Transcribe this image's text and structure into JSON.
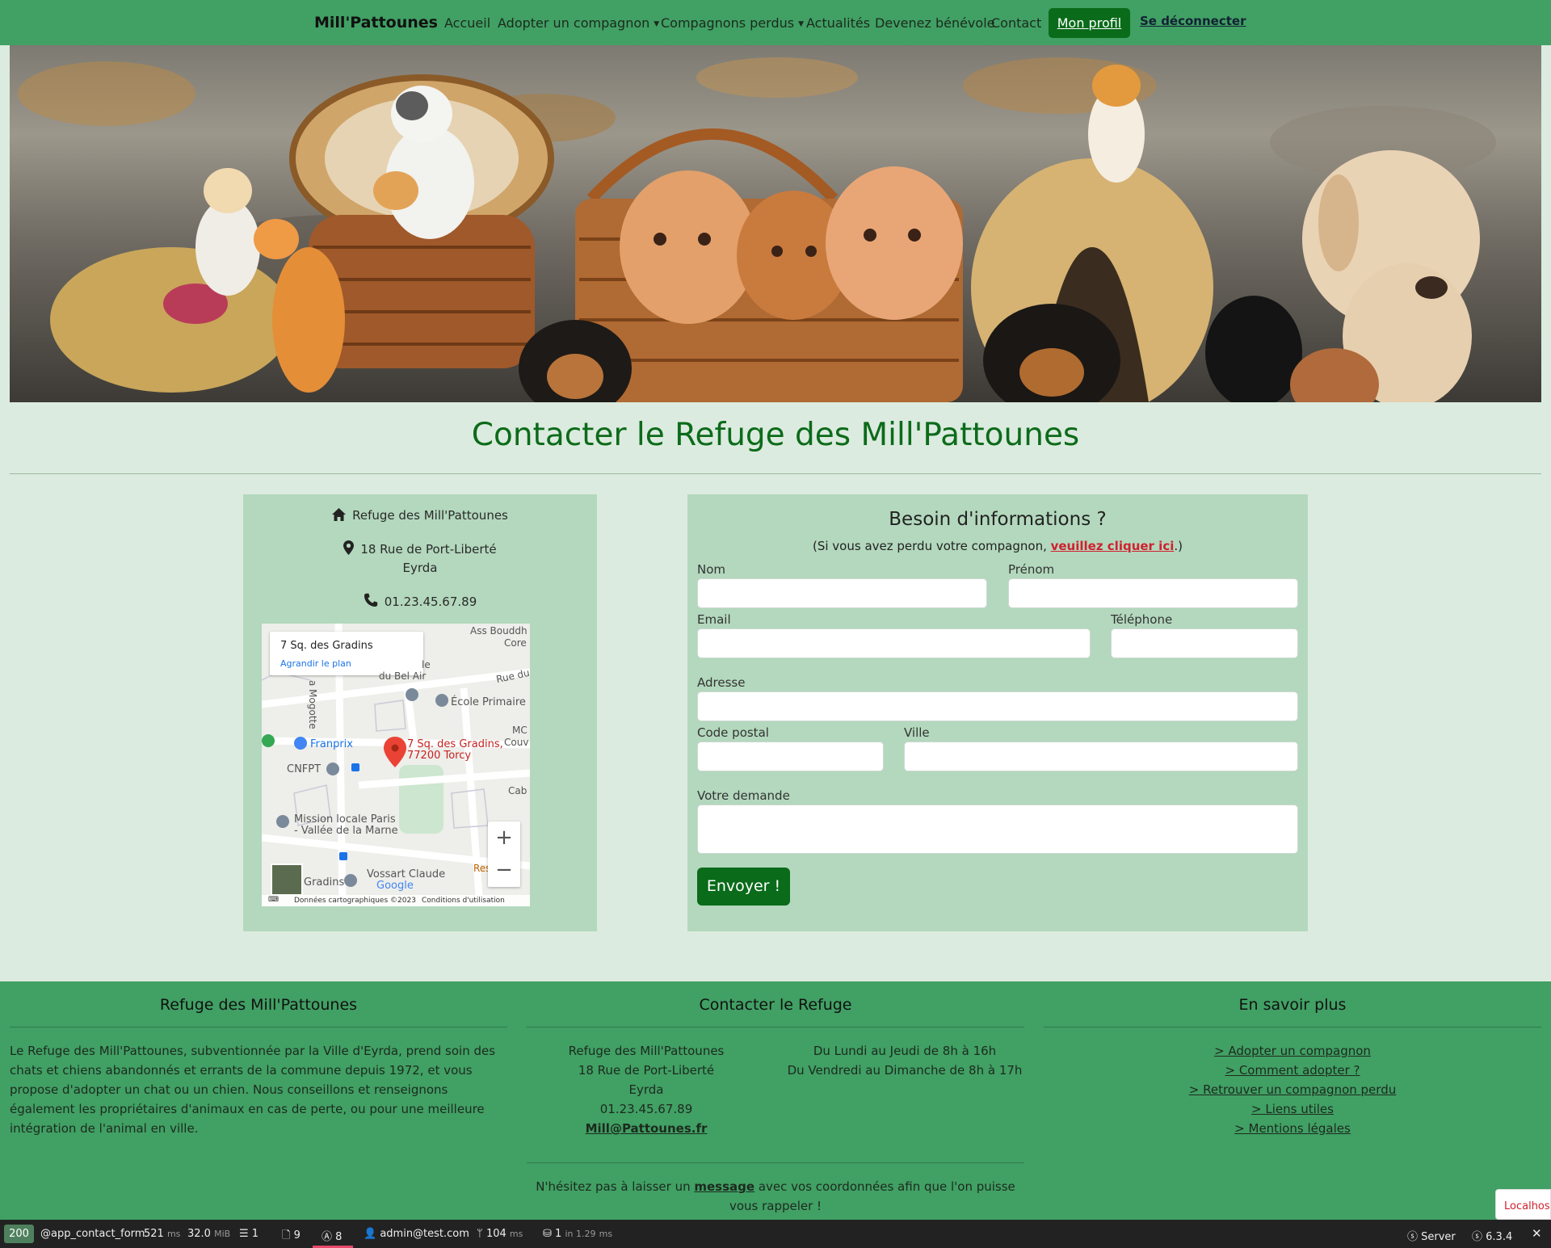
{
  "nav": {
    "brand": "Mill'Pattounes",
    "items": [
      "Accueil",
      "Adopter un compagnon",
      "Compagnons perdus",
      "Actualités",
      "Devenez bénévole",
      "Contact"
    ],
    "profile": "Mon profil",
    "logout": "Se déconnecter"
  },
  "page": {
    "title": "Contacter le Refuge des Mill'Pattounes"
  },
  "info": {
    "name": "Refuge des Mill'Pattounes",
    "street": "18 Rue de Port-Liberté",
    "city": "Eyrda",
    "phone": "01.23.45.67.89"
  },
  "map": {
    "place": "7 Sq. des Gradins",
    "enlarge": "Agrandir le plan",
    "marker_line1": "7 Sq. des Gradins,",
    "marker_line2": "77200 Torcy",
    "labels": {
      "franprix": "Franprix",
      "cnfpt": "CNFPT",
      "ecole": "École Primaire",
      "mission1": "Mission locale Paris",
      "mission2": "- Vallée de la Marne",
      "vossart": "Vossart Claude",
      "gradins": "Gradins",
      "ass": "Ass Bouddh",
      "core": "Core",
      "ruedu": "Rue du",
      "belair": "du Bel Air",
      "le": "le",
      "mc": "MC",
      "couv": "Couv",
      "cab": "Cab",
      "res": "Res",
      "mogotte": "a Mogotte",
      "google": "Google"
    },
    "footer_data": "Données cartographiques ©2023",
    "footer_terms": "Conditions d'utilisation"
  },
  "form": {
    "title": "Besoin d'informations ?",
    "sub_before": "(Si vous avez perdu votre compagnon, ",
    "sub_link": "veuillez cliquer ici",
    "sub_after": ".)",
    "labels": {
      "nom": "Nom",
      "prenom": "Prénom",
      "email": "Email",
      "telephone": "Téléphone",
      "adresse": "Adresse",
      "code_postal": "Code postal",
      "ville": "Ville",
      "demande": "Votre demande"
    },
    "submit": "Envoyer !"
  },
  "footer": {
    "col1_title": "Refuge des Mill'Pattounes",
    "col1_text": "Le Refuge des Mill'Pattounes, subventionnée par la Ville d'Eyrda, prend soin des chats et chiens abandonnés et errants de la commune depuis 1972, et vous propose d'adopter un chat ou un chien. Nous conseillons et renseignons également les propriétaires d'animaux en cas de perte, ou pour une meilleure intégration de l'animal en ville.",
    "col2_title": "Contacter le Refuge",
    "col2_name": "Refuge des Mill'Pattounes",
    "col2_street": "18 Rue de Port-Liberté",
    "col2_city": "Eyrda",
    "col2_phone": "01.23.45.67.89",
    "col2_email": "Mill@Pattounes.fr",
    "hours1": "Du Lundi au Jeudi de 8h à 16h",
    "hours2": "Du Vendredi au Dimanche de 8h à 17h",
    "msg_before": "N'hésitez pas à laisser un ",
    "msg_link": "message",
    "msg_after": " avec vos coordonnées afin que l'on puisse vous rappeler !",
    "col3_title": "En savoir plus",
    "links": [
      "> Adopter un compagnon",
      "> Comment adopter ?",
      "> Retrouver un compagnon perdu",
      "> Liens utiles",
      "> Mentions légales"
    ]
  },
  "debug": {
    "status": "200",
    "route": "@app_contact_form",
    "time": "521",
    "time_unit": "ms",
    "memory": "32.0",
    "memory_unit": "MiB",
    "forms": "1",
    "logs": "9",
    "translations": "8",
    "user": "admin@test.com",
    "twig": "104",
    "twig_unit": "ms",
    "db": "1",
    "db_in": "in 1.29",
    "db_unit": "ms",
    "server": "Server",
    "version": "6.3.4"
  },
  "localhost_badge": "Localhost"
}
